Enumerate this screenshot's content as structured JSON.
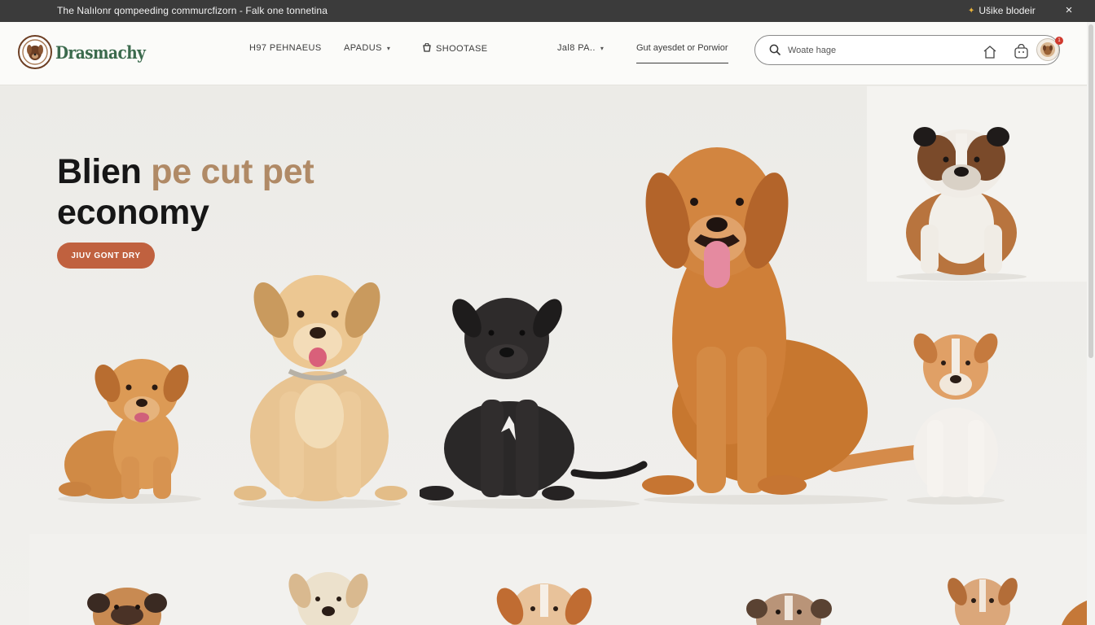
{
  "announcement": {
    "message": "The Nalılonr qompeeding commurcfizorn - Falk one tonnetina",
    "promo_label": "Ušike blodeir",
    "close_glyph": "×"
  },
  "brand": {
    "name": "Drasmachy"
  },
  "nav": {
    "items": [
      {
        "label": "H97 PEHNAEUS"
      },
      {
        "label": "APADUS",
        "caret": "▾"
      },
      {
        "label": "SHOOTASE"
      },
      {
        "label": "Jal8 PA..",
        "caret": "▾"
      },
      {
        "label": "Gut ayesdet or Porwior"
      }
    ]
  },
  "search": {
    "placeholder": "Woate hage"
  },
  "header_icons": [
    "home-icon",
    "shopping-bag-icon",
    "profile-avatar-icon"
  ],
  "notification": {
    "count": "1"
  },
  "hero": {
    "headline_line1_start": "Blien ",
    "headline_accent": "pe cut pet",
    "headline_line2": "economy",
    "cta_label": "JIUV GONT DRY"
  },
  "colors": {
    "topbar_bg": "#3b3b3b",
    "brand_green": "#3b6a4d",
    "accent_tan": "#b08a66",
    "cta_orange": "#c0613f",
    "badge_red": "#d0392e"
  }
}
